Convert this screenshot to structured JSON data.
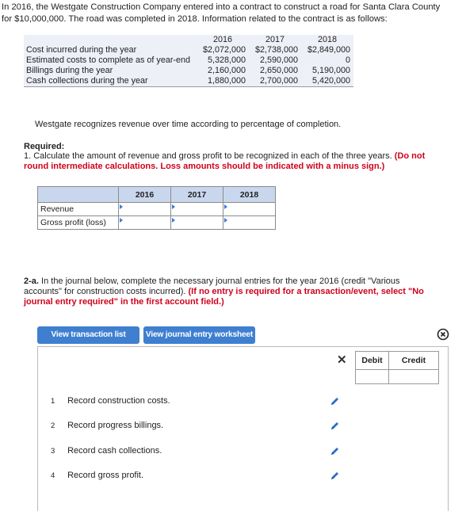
{
  "intro": "In 2016, the Westgate Construction Company entered into a contract to construct a road for Santa Clara County for $10,000,000. The road was completed in 2018. Information related to the contract is as follows:",
  "info_table": {
    "headers": [
      "",
      "2016",
      "2017",
      "2018"
    ],
    "rows": [
      [
        "Cost incurred during the year",
        "$2,072,000",
        "$2,738,000",
        "$2,849,000"
      ],
      [
        "Estimated costs to complete as of year-end",
        "5,328,000",
        "2,590,000",
        "0"
      ],
      [
        "Billings during the year",
        "2,160,000",
        "2,650,000",
        "5,190,000"
      ],
      [
        "Cash collections during the year",
        "1,880,000",
        "2,700,000",
        "5,420,000"
      ]
    ]
  },
  "recognition_note": "Westgate recognizes revenue over time according to percentage of completion.",
  "required": {
    "heading": "Required:",
    "text": "1. Calculate the amount of revenue and gross profit to be recognized in each of the three years.",
    "note": "(Do not round intermediate calculations. Loss amounts should be indicated with a minus sign.)"
  },
  "calc_table": {
    "headers": [
      "2016",
      "2017",
      "2018"
    ],
    "rows": [
      "Revenue",
      "Gross profit (loss)"
    ]
  },
  "question_2a": {
    "prefix": "2-a.",
    "text": "In the journal below, complete the necessary journal entries for the year 2016 (credit \"Various accounts\" for construction costs incurred).",
    "note": "(If no entry is required for a transaction/event, select \"No journal entry required\" in the first account field.)"
  },
  "buttons": {
    "view_transaction_list": "View transaction list",
    "view_journal_worksheet": "View journal entry worksheet"
  },
  "journal_panel": {
    "close_symbol": "✕",
    "columns": [
      "Debit",
      "Credit"
    ],
    "tasks": [
      {
        "num": "1",
        "label": "Record construction costs."
      },
      {
        "num": "2",
        "label": "Record progress billings."
      },
      {
        "num": "3",
        "label": "Record cash collections."
      },
      {
        "num": "4",
        "label": "Record gross profit."
      }
    ]
  },
  "colors": {
    "accent": "#3f7fd0",
    "required_red": "#d0021b",
    "table_bg": "#eef0f8",
    "header_blue": "#c9d7ee"
  }
}
